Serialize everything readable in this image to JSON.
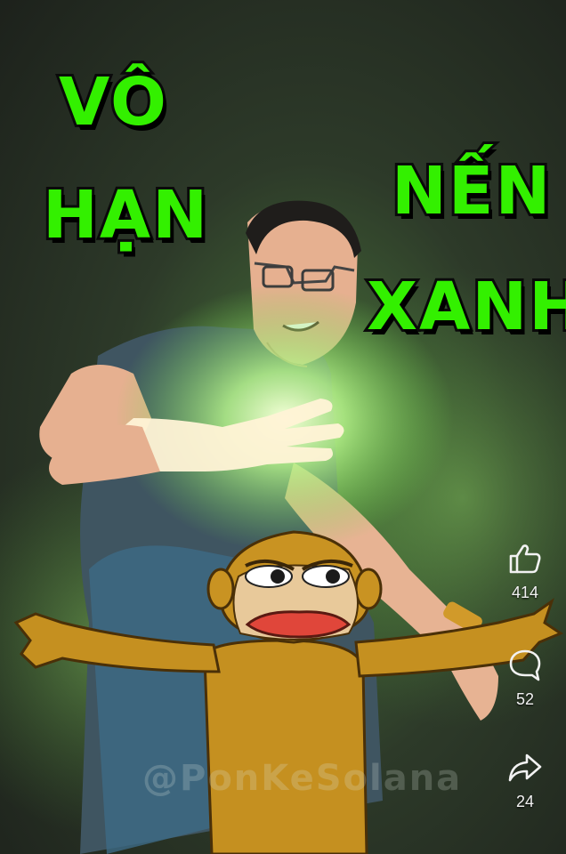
{
  "video": {
    "captions": {
      "line1": "VÔ",
      "line2": "HẠN",
      "line3": "NẾN",
      "line4": "XANH"
    },
    "watermark": "@PonKeSolana",
    "colors": {
      "caption_fill": "#33f000",
      "caption_outline": "#0a0a0a",
      "glow": "#b6f58a",
      "background": "#1d211c"
    }
  },
  "actions": {
    "like": {
      "icon": "thumbs-up-icon",
      "count": "414"
    },
    "comment": {
      "icon": "comment-bubble-icon",
      "count": "52"
    },
    "share": {
      "icon": "share-arrow-icon",
      "count": "24"
    }
  }
}
